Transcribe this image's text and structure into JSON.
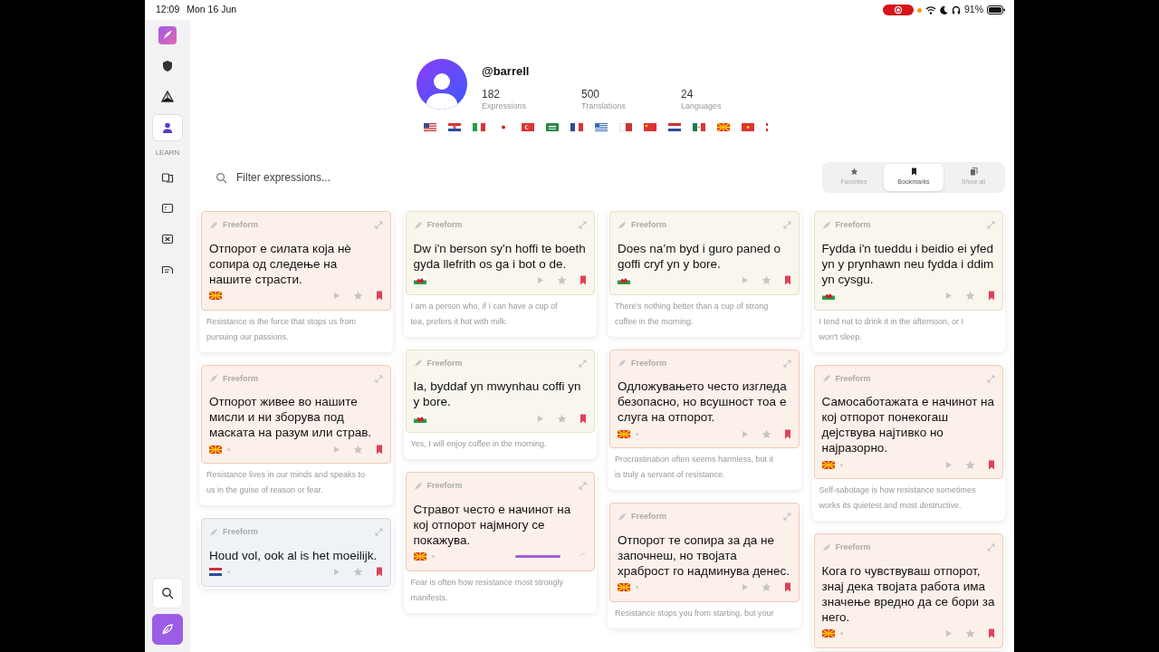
{
  "status_bar": {
    "time": "12:09",
    "date": "Mon 16 Jun",
    "battery_text": "91%"
  },
  "sidebar": {
    "items": [
      {
        "kind": "logo",
        "selected": false
      },
      {
        "kind": "shield",
        "selected": false
      },
      {
        "kind": "pyramid",
        "selected": false
      },
      {
        "kind": "person",
        "selected": true
      },
      {
        "kind": "label",
        "text": "LEARN"
      },
      {
        "kind": "cards",
        "selected": false
      },
      {
        "kind": "screen",
        "selected": false
      },
      {
        "kind": "grid",
        "selected": false
      },
      {
        "kind": "list",
        "selected": false
      }
    ],
    "bottom": [
      {
        "kind": "search",
        "selected": false
      },
      {
        "kind": "feather",
        "selected": true
      }
    ]
  },
  "profile": {
    "username": "@barrell",
    "stats": [
      {
        "value": "182",
        "label": "Expressions"
      },
      {
        "value": "500",
        "label": "Translations"
      },
      {
        "value": "24",
        "label": "Languages"
      }
    ],
    "flags": [
      {
        "kind": "us"
      },
      {
        "kind": "hr"
      },
      {
        "kind": "it"
      },
      {
        "kind": "jp"
      },
      {
        "kind": "tr"
      },
      {
        "kind": "sa"
      },
      {
        "kind": "fr"
      },
      {
        "kind": "gr"
      },
      {
        "kind": "mt"
      },
      {
        "kind": "cn"
      },
      {
        "kind": "nl"
      },
      {
        "kind": "mx"
      },
      {
        "kind": "mk"
      },
      {
        "kind": "vn"
      },
      {
        "kind": "cut"
      }
    ]
  },
  "filter": {
    "placeholder": "Filter expressions..."
  },
  "tabs": [
    {
      "label": "Favorites",
      "kind": "star",
      "selected": false
    },
    {
      "label": "Bookmarks",
      "kind": "bookmark",
      "selected": true
    },
    {
      "label": "Show all",
      "kind": "pages",
      "selected": false
    }
  ],
  "columns": [
    {
      "cards": [
        {
          "type_label": "Freeform",
          "text": "Отпорот е силата која нè сопира од следење на нашите страсти.",
          "flag": {
            "kind": "mk"
          },
          "dot": false,
          "loading": false,
          "favorite": false,
          "bookmarked": true,
          "translation": "Resistance is the force that stops us from pursuing our passions."
        },
        {
          "type_label": "Freeform",
          "text": "Отпорот живее во нашите мисли и ни зборува под маската на разум или страв.",
          "flag": {
            "kind": "mk"
          },
          "dot": true,
          "loading": false,
          "favorite": false,
          "bookmarked": true,
          "translation": "Resistance lives in our minds and speaks to us in the guise of reason or fear."
        },
        {
          "type_label": "Freeform",
          "text": "Houd vol, ook al is het moeilijk.",
          "flag": {
            "kind": "nl"
          },
          "dot": true,
          "loading": false,
          "favorite": false,
          "bookmarked": true
        }
      ]
    },
    {
      "cards": [
        {
          "type_label": "Freeform",
          "text": "Dw i'n berson sy'n hoffi te boeth gyda llefrith os ga i bot o de.",
          "flag": {
            "kind": "wales"
          },
          "dot": false,
          "loading": false,
          "favorite": false,
          "bookmarked": true,
          "translation": "I am a person who, if I can have a cup of tea, prefers it hot with milk."
        },
        {
          "type_label": "Freeform",
          "text": "Ia, byddaf yn mwynhau coffi yn y bore.",
          "flag": {
            "kind": "wales"
          },
          "dot": false,
          "loading": false,
          "favorite": false,
          "bookmarked": true,
          "translation": "Yes, I will enjoy coffee in the morning."
        },
        {
          "type_label": "Freeform",
          "text": "Стравот често е начинот на кој отпорот најмногу се покажува.",
          "flag": {
            "kind": "mk"
          },
          "dot": true,
          "loading": true,
          "translation": "Fear is often how resistance most strongly manifests."
        }
      ]
    },
    {
      "cards": [
        {
          "type_label": "Freeform",
          "text": "Does na’m byd i guro paned o goffi cryf yn y bore.",
          "flag": {
            "kind": "wales"
          },
          "dot": false,
          "loading": false,
          "favorite": false,
          "bookmarked": true,
          "translation": "There's nothing better than a cup of strong coffee in the morning."
        },
        {
          "type_label": "Freeform",
          "text": "Одложувањето често изгледа безопасно, но всушност тоа е слуга на отпорот.",
          "flag": {
            "kind": "mk"
          },
          "dot": true,
          "loading": false,
          "favorite": false,
          "bookmarked": true,
          "translation": "Procrastination often seems harmless, but it is truly a servant of resistance."
        },
        {
          "type_label": "Freeform",
          "text": "Отпорот те сопира за да не започнеш, но твојата храброст го надминува денес.",
          "flag": {
            "kind": "mk"
          },
          "dot": true,
          "loading": false,
          "favorite": false,
          "bookmarked": true,
          "translation": "Resistance stops you from starting, but your"
        }
      ]
    },
    {
      "cards": [
        {
          "type_label": "Freeform",
          "text": "Fydda i'n tueddu i beidio ei yfed yn y prynhawn neu fydda i ddim yn cysgu.",
          "flag": {
            "kind": "wales"
          },
          "dot": false,
          "loading": false,
          "favorite": false,
          "bookmarked": true,
          "translation": "I tend not to drink it in the afternoon, or I won't sleep."
        },
        {
          "type_label": "Freeform",
          "text": "Самосаботажата е начинот на кој отпорот понекогаш дејствува најтивко но најразорно.",
          "flag": {
            "kind": "mk"
          },
          "dot": true,
          "loading": false,
          "favorite": false,
          "bookmarked": true,
          "translation": "Self-sabotage is how resistance sometimes works its quietest and most destructive."
        },
        {
          "type_label": "Freeform",
          "text": "Кога го чувствуваш отпорот, знај дека твојата работа има значење вредно да се бори за него.",
          "flag": {
            "kind": "mk"
          },
          "dot": true,
          "loading": false,
          "favorite": false,
          "bookmarked": true
        }
      ]
    }
  ]
}
